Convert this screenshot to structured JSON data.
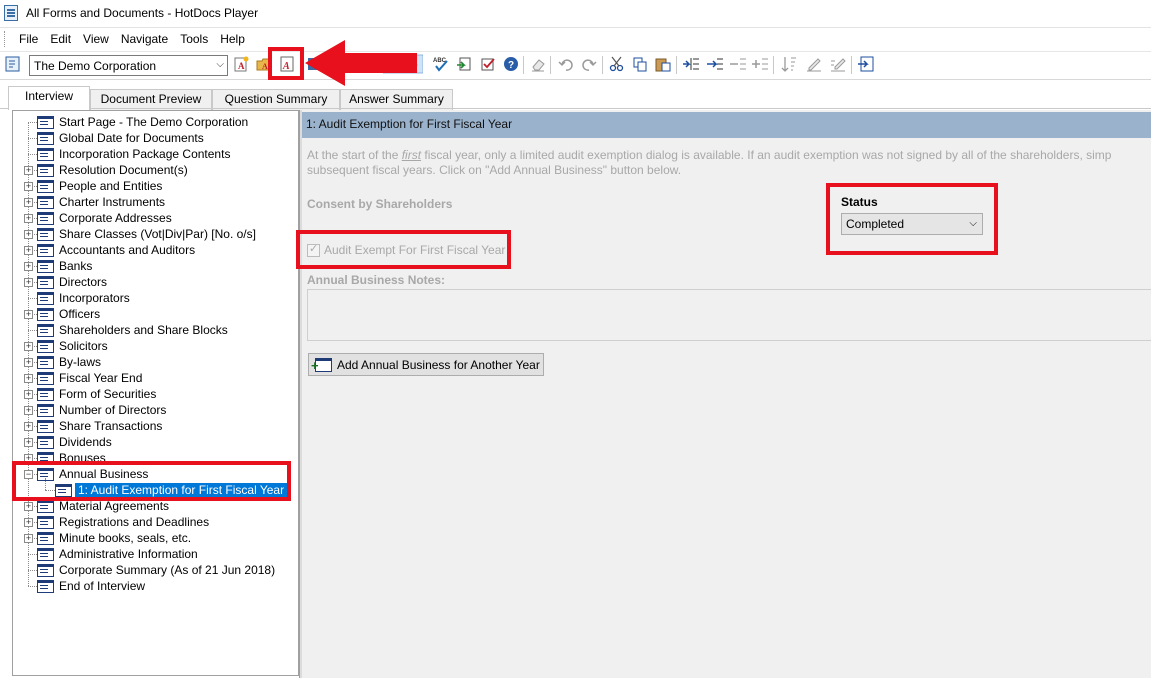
{
  "window": {
    "title": "All Forms and Documents - HotDocs Player"
  },
  "menu": {
    "items": [
      "File",
      "Edit",
      "View",
      "Navigate",
      "Tools",
      "Help"
    ]
  },
  "toolbar": {
    "combo_value": "The Demo Corporation",
    "icons": [
      "app-refresh-icon",
      "answer-file-new-icon",
      "answer-file-open-icon",
      "answer-file-pdf-icon",
      "save-answers-icon",
      "highlight-icon",
      "spell-check-icon",
      "assemble-icon",
      "check-icon",
      "help-icon",
      "erase-icon",
      "undo-icon",
      "redo-icon",
      "cut-icon",
      "copy-icon",
      "paste-icon",
      "insert-row-icon",
      "add-row-icon",
      "delete-row-icon",
      "move-row-icon",
      "sort-icon",
      "edit-icon",
      "edit-all-icon",
      "exit-icon"
    ]
  },
  "tabs": [
    {
      "label": "Interview",
      "active": true
    },
    {
      "label": "Document Preview",
      "active": false
    },
    {
      "label": "Question Summary",
      "active": false
    },
    {
      "label": "Answer Summary",
      "active": false
    }
  ],
  "tree": [
    {
      "label": "Start Page - The Demo Corporation",
      "expander": ""
    },
    {
      "label": "Global Date for Documents",
      "expander": ""
    },
    {
      "label": "Incorporation Package Contents",
      "expander": ""
    },
    {
      "label": "Resolution Document(s)",
      "expander": "+"
    },
    {
      "label": "People and Entities",
      "expander": "+"
    },
    {
      "label": "Charter Instruments",
      "expander": "+"
    },
    {
      "label": "Corporate Addresses",
      "expander": "+"
    },
    {
      "label": "Share Classes (Vot|Div|Par) [No. o/s]",
      "expander": "+"
    },
    {
      "label": "Accountants and Auditors",
      "expander": "+"
    },
    {
      "label": "Banks",
      "expander": "+"
    },
    {
      "label": "Directors",
      "expander": "+"
    },
    {
      "label": "Incorporators",
      "expander": ""
    },
    {
      "label": "Officers",
      "expander": "+"
    },
    {
      "label": "Shareholders and Share Blocks",
      "expander": ""
    },
    {
      "label": "Solicitors",
      "expander": "+"
    },
    {
      "label": "By-laws",
      "expander": "+"
    },
    {
      "label": "Fiscal Year End",
      "expander": "+"
    },
    {
      "label": "Form of Securities",
      "expander": "+"
    },
    {
      "label": "Number of Directors",
      "expander": "+"
    },
    {
      "label": "Share Transactions",
      "expander": "+"
    },
    {
      "label": "Dividends",
      "expander": "+"
    },
    {
      "label": "Bonuses",
      "expander": "+"
    },
    {
      "label": "Annual Business",
      "expander": "-"
    },
    {
      "label": "1: Audit Exemption for First Fiscal Year",
      "expander": "",
      "child": true,
      "selected": true
    },
    {
      "label": "Material Agreements",
      "expander": "+"
    },
    {
      "label": "Registrations and Deadlines",
      "expander": "+"
    },
    {
      "label": "Minute books, seals, etc.",
      "expander": "+"
    },
    {
      "label": "Administrative Information",
      "expander": ""
    },
    {
      "label": "Corporate Summary (As of 21 Jun 2018)",
      "expander": ""
    },
    {
      "label": "End of Interview",
      "expander": ""
    }
  ],
  "dialog": {
    "header": "1: Audit Exemption for First Fiscal Year",
    "description_part1": "At the start of the ",
    "description_emphasis": "first",
    "description_part2": " fiscal year, only a limited audit exemption dialog is available.  If an audit exemption was not signed by all of the shareholders, simp",
    "description_line2": "subsequent fiscal years.  Click on \"Add Annual Business\" button below.",
    "section_title": "Consent by Shareholders",
    "status_label": "Status",
    "status_value": "Completed",
    "checkbox_label": "Audit Exempt For First Fiscal Year",
    "checkbox_checked": true,
    "notes_label": "Annual Business Notes:",
    "notes_value": "",
    "add_button_label": "Add Annual Business for Another Year"
  },
  "colors": {
    "highlight": "#e8101c",
    "header_bg": "#9ab2cc",
    "selection": "#0078d7"
  }
}
